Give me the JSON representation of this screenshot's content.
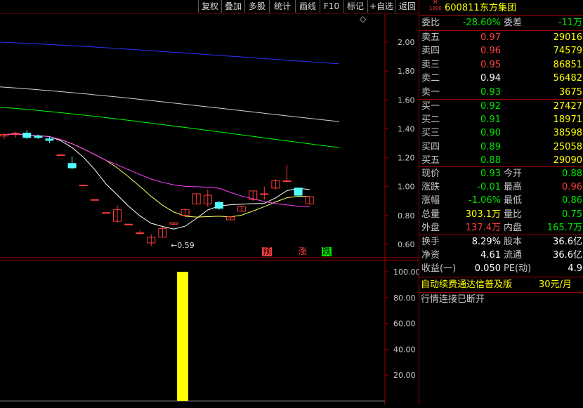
{
  "toolbar": {
    "buttons": [
      "复权",
      "叠加",
      "多股",
      "统计",
      "画线",
      "F10",
      "标记",
      "+自选",
      "返回"
    ]
  },
  "chart": {
    "price_axis": [
      "2.00",
      "1.80",
      "1.60",
      "1.40",
      "1.20",
      "1.00",
      "0.80",
      "0.60"
    ],
    "volume_axis": [
      "100.00",
      "80.00",
      "60.00",
      "40.00",
      "20.00"
    ],
    "low_label": "0.59",
    "markers": [
      "预",
      "涨",
      "跌"
    ],
    "diamond": "◇",
    "colors": {
      "up": "#ff3c3c",
      "down": "#54ffff",
      "ma1": "#ffffff",
      "ma2": "#ffff66",
      "ma3": "#ff40ff",
      "ma4": "#00ff00",
      "ma5": "#d0d0d0",
      "ma6": "#3030ff",
      "volume": "#ffff00"
    }
  },
  "chart_data": {
    "type": "candlestick",
    "ylim": [
      0.55,
      2.1
    ],
    "candles": [
      {
        "o": 1.35,
        "h": 1.37,
        "l": 1.33,
        "c": 1.36
      },
      {
        "o": 1.36,
        "h": 1.38,
        "l": 1.34,
        "c": 1.37
      },
      {
        "o": 1.37,
        "h": 1.39,
        "l": 1.33,
        "c": 1.34
      },
      {
        "o": 1.35,
        "h": 1.36,
        "l": 1.33,
        "c": 1.34
      },
      {
        "o": 1.33,
        "h": 1.35,
        "l": 1.3,
        "c": 1.32
      },
      {
        "o": 1.22,
        "h": 1.22,
        "l": 1.22,
        "c": 1.22
      },
      {
        "o": 1.16,
        "h": 1.21,
        "l": 1.12,
        "c": 1.13
      },
      {
        "o": 1.01,
        "h": 1.01,
        "l": 1.01,
        "c": 1.01
      },
      {
        "o": 0.91,
        "h": 0.91,
        "l": 0.91,
        "c": 0.91
      },
      {
        "o": 0.82,
        "h": 0.82,
        "l": 0.82,
        "c": 0.82
      },
      {
        "o": 0.76,
        "h": 0.87,
        "l": 0.75,
        "c": 0.84
      },
      {
        "o": 0.74,
        "h": 0.74,
        "l": 0.74,
        "c": 0.74
      },
      {
        "o": 0.68,
        "h": 0.7,
        "l": 0.67,
        "c": 0.68
      },
      {
        "o": 0.61,
        "h": 0.67,
        "l": 0.59,
        "c": 0.65
      },
      {
        "o": 0.65,
        "h": 0.72,
        "l": 0.65,
        "c": 0.71
      },
      {
        "o": 0.74,
        "h": 0.75,
        "l": 0.73,
        "c": 0.75
      },
      {
        "o": 0.8,
        "h": 0.85,
        "l": 0.8,
        "c": 0.84
      },
      {
        "o": 0.88,
        "h": 0.95,
        "l": 0.88,
        "c": 0.95
      },
      {
        "o": 0.88,
        "h": 0.98,
        "l": 0.86,
        "c": 0.94
      },
      {
        "o": 0.89,
        "h": 0.9,
        "l": 0.84,
        "c": 0.85
      },
      {
        "o": 0.77,
        "h": 0.8,
        "l": 0.77,
        "c": 0.79
      },
      {
        "o": 0.83,
        "h": 0.86,
        "l": 0.83,
        "c": 0.86
      },
      {
        "o": 0.91,
        "h": 0.97,
        "l": 0.9,
        "c": 0.97
      },
      {
        "o": 0.95,
        "h": 1.0,
        "l": 0.91,
        "c": 0.95
      },
      {
        "o": 0.99,
        "h": 1.05,
        "l": 0.98,
        "c": 1.04
      },
      {
        "o": 1.04,
        "h": 1.15,
        "l": 1.03,
        "c": 1.04
      },
      {
        "o": 0.99,
        "h": 0.99,
        "l": 0.93,
        "c": 0.94
      },
      {
        "o": 0.88,
        "h": 0.93,
        "l": 0.88,
        "c": 0.93
      }
    ],
    "volume": [
      {
        "index": 13,
        "value": 100
      }
    ]
  },
  "stock": {
    "badge_top": "R",
    "badge_bottom": "1000",
    "code": "600811",
    "name": "东方集团"
  },
  "quote": {
    "weibi_label": "委比",
    "weibi": "-28.60%",
    "weicha_label": "委差",
    "weicha": "-11万",
    "asks": [
      {
        "label": "卖五",
        "price": "0.97",
        "vol": "29016",
        "color": "red"
      },
      {
        "label": "卖四",
        "price": "0.96",
        "vol": "74579",
        "color": "red"
      },
      {
        "label": "卖三",
        "price": "0.95",
        "vol": "86851",
        "color": "red"
      },
      {
        "label": "卖二",
        "price": "0.94",
        "vol": "56482",
        "color": "white"
      },
      {
        "label": "卖一",
        "price": "0.93",
        "vol": "3675",
        "color": "green"
      }
    ],
    "bids": [
      {
        "label": "买一",
        "price": "0.92",
        "vol": "27427",
        "color": "green"
      },
      {
        "label": "买二",
        "price": "0.91",
        "vol": "18971",
        "color": "green"
      },
      {
        "label": "买三",
        "price": "0.90",
        "vol": "38598",
        "color": "green"
      },
      {
        "label": "买四",
        "price": "0.89",
        "vol": "25058",
        "color": "green"
      },
      {
        "label": "买五",
        "price": "0.88",
        "vol": "29090",
        "color": "green"
      }
    ],
    "stats": [
      {
        "l1": "现价",
        "v1": "0.93",
        "c1": "green",
        "l2": "今开",
        "v2": "0.88",
        "c2": "green"
      },
      {
        "l1": "涨跌",
        "v1": "-0.01",
        "c1": "green",
        "l2": "最高",
        "v2": "0.96",
        "c2": "red"
      },
      {
        "l1": "涨幅",
        "v1": "-1.06%",
        "c1": "green",
        "l2": "最低",
        "v2": "0.86",
        "c2": "green"
      },
      {
        "l1": "总量",
        "v1": "303.1万",
        "c1": "yellow",
        "l2": "量比",
        "v2": "0.75",
        "c2": "green"
      },
      {
        "l1": "外盘",
        "v1": "137.4万",
        "c1": "red",
        "l2": "内盘",
        "v2": "165.7万",
        "c2": "green"
      }
    ],
    "fund": [
      {
        "l1": "换手",
        "v1": "8.29%",
        "l2": "股本",
        "v2": "36.6亿"
      },
      {
        "l1": "净资",
        "v1": "4.61",
        "l2": "流通",
        "v2": "36.6亿"
      },
      {
        "l1": "收益(一)",
        "v1": "0.050",
        "l2": "PE(动)",
        "v2": "4.9"
      }
    ],
    "ad_text": "自动续费通达信普及版",
    "ad_price": "30元/月",
    "status": "行情连接已断开"
  }
}
